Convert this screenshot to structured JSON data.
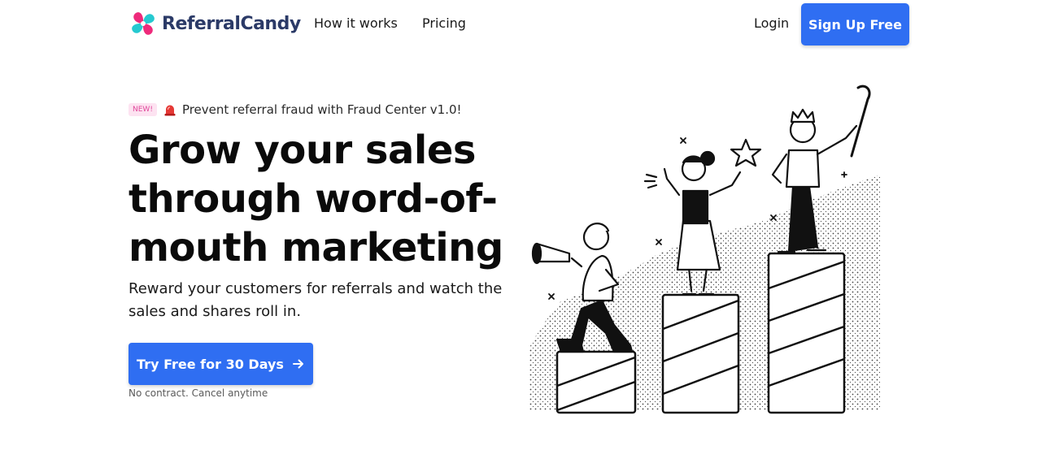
{
  "nav": {
    "brand": "ReferralCandy",
    "links": [
      "How it works",
      "Pricing"
    ],
    "login": "Login",
    "signup": "Sign Up Free"
  },
  "hero": {
    "badge": "NEW!",
    "announcement": "Prevent referral fraud with Fraud Center v1.0!",
    "headline": "Grow your sales through word-of-mouth marketing",
    "subtext": "Reward your customers for referrals and watch the sales and shares roll in.",
    "cta": "Try Free for 30 Days",
    "fineprint": "No contract. Cancel anytime"
  },
  "icons": {
    "logo": "referralcandy-logo-icon",
    "siren": "siren-icon",
    "arrow": "arrow-right-icon"
  },
  "colors": {
    "accent": "#2f6ef2",
    "brand_text": "#2b3a67",
    "logo_pink": "#ee2a7b",
    "logo_cyan": "#25c9d0",
    "badge_bg": "#fde3f1",
    "badge_text": "#e0479a"
  }
}
